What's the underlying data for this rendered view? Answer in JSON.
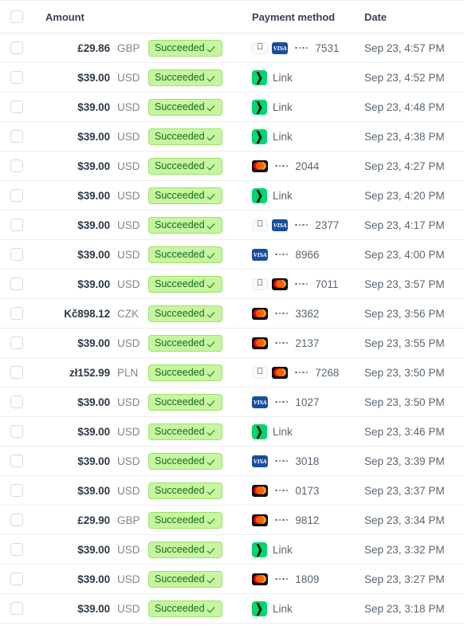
{
  "table": {
    "columns": {
      "select_all": "",
      "amount": "Amount",
      "payment_method": "Payment method",
      "date": "Date"
    },
    "status_label": "Succeeded",
    "link_label": "Link",
    "colors": {
      "badge_bg": "#c6f6a0",
      "badge_border": "#9fe16a",
      "badge_text": "#1a6b20",
      "link_green": "#00d66f",
      "visa_blue": "#1a4f9c",
      "mastercard_black": "#0a0a0a",
      "row_border": "#ebeef1",
      "amount_text": "#2e3a47",
      "muted_text": "#7b8794"
    },
    "rows": [
      {
        "amount": "£29.86",
        "currency": "GBP",
        "status": "Succeeded",
        "method_type": "card",
        "icons": [
          "applepay",
          "visa"
        ],
        "last4": "7531",
        "date": "Sep 23, 4:57 PM"
      },
      {
        "amount": "$39.00",
        "currency": "USD",
        "status": "Succeeded",
        "method_type": "link",
        "icons": [
          "link"
        ],
        "last4": "",
        "date": "Sep 23, 4:52 PM"
      },
      {
        "amount": "$39.00",
        "currency": "USD",
        "status": "Succeeded",
        "method_type": "link",
        "icons": [
          "link"
        ],
        "last4": "",
        "date": "Sep 23, 4:48 PM"
      },
      {
        "amount": "$39.00",
        "currency": "USD",
        "status": "Succeeded",
        "method_type": "link",
        "icons": [
          "link"
        ],
        "last4": "",
        "date": "Sep 23, 4:38 PM"
      },
      {
        "amount": "$39.00",
        "currency": "USD",
        "status": "Succeeded",
        "method_type": "card",
        "icons": [
          "mastercard"
        ],
        "last4": "2044",
        "date": "Sep 23, 4:27 PM"
      },
      {
        "amount": "$39.00",
        "currency": "USD",
        "status": "Succeeded",
        "method_type": "link",
        "icons": [
          "link"
        ],
        "last4": "",
        "date": "Sep 23, 4:20 PM"
      },
      {
        "amount": "$39.00",
        "currency": "USD",
        "status": "Succeeded",
        "method_type": "card",
        "icons": [
          "applepay",
          "visa"
        ],
        "last4": "2377",
        "date": "Sep 23, 4:17 PM"
      },
      {
        "amount": "$39.00",
        "currency": "USD",
        "status": "Succeeded",
        "method_type": "card",
        "icons": [
          "visa"
        ],
        "last4": "8966",
        "date": "Sep 23, 4:00 PM"
      },
      {
        "amount": "$39.00",
        "currency": "USD",
        "status": "Succeeded",
        "method_type": "card",
        "icons": [
          "applepay",
          "mastercard"
        ],
        "last4": "7011",
        "date": "Sep 23, 3:57 PM"
      },
      {
        "amount": "Kč898.12",
        "currency": "CZK",
        "status": "Succeeded",
        "method_type": "card",
        "icons": [
          "mastercard"
        ],
        "last4": "3362",
        "date": "Sep 23, 3:56 PM"
      },
      {
        "amount": "$39.00",
        "currency": "USD",
        "status": "Succeeded",
        "method_type": "card",
        "icons": [
          "mastercard"
        ],
        "last4": "2137",
        "date": "Sep 23, 3:55 PM"
      },
      {
        "amount": "zł152.99",
        "currency": "PLN",
        "status": "Succeeded",
        "method_type": "card",
        "icons": [
          "applepay",
          "mastercard"
        ],
        "last4": "7268",
        "date": "Sep 23, 3:50 PM"
      },
      {
        "amount": "$39.00",
        "currency": "USD",
        "status": "Succeeded",
        "method_type": "card",
        "icons": [
          "visa"
        ],
        "last4": "1027",
        "date": "Sep 23, 3:50 PM"
      },
      {
        "amount": "$39.00",
        "currency": "USD",
        "status": "Succeeded",
        "method_type": "link",
        "icons": [
          "link"
        ],
        "last4": "",
        "date": "Sep 23, 3:46 PM"
      },
      {
        "amount": "$39.00",
        "currency": "USD",
        "status": "Succeeded",
        "method_type": "card",
        "icons": [
          "visa"
        ],
        "last4": "3018",
        "date": "Sep 23, 3:39 PM"
      },
      {
        "amount": "$39.00",
        "currency": "USD",
        "status": "Succeeded",
        "method_type": "card",
        "icons": [
          "mastercard"
        ],
        "last4": "0173",
        "date": "Sep 23, 3:37 PM"
      },
      {
        "amount": "£29.90",
        "currency": "GBP",
        "status": "Succeeded",
        "method_type": "card",
        "icons": [
          "mastercard"
        ],
        "last4": "9812",
        "date": "Sep 23, 3:34 PM"
      },
      {
        "amount": "$39.00",
        "currency": "USD",
        "status": "Succeeded",
        "method_type": "link",
        "icons": [
          "link"
        ],
        "last4": "",
        "date": "Sep 23, 3:32 PM"
      },
      {
        "amount": "$39.00",
        "currency": "USD",
        "status": "Succeeded",
        "method_type": "card",
        "icons": [
          "mastercard"
        ],
        "last4": "1809",
        "date": "Sep 23, 3:27 PM"
      },
      {
        "amount": "$39.00",
        "currency": "USD",
        "status": "Succeeded",
        "method_type": "link",
        "icons": [
          "link"
        ],
        "last4": "",
        "date": "Sep 23, 3:18 PM"
      }
    ]
  }
}
